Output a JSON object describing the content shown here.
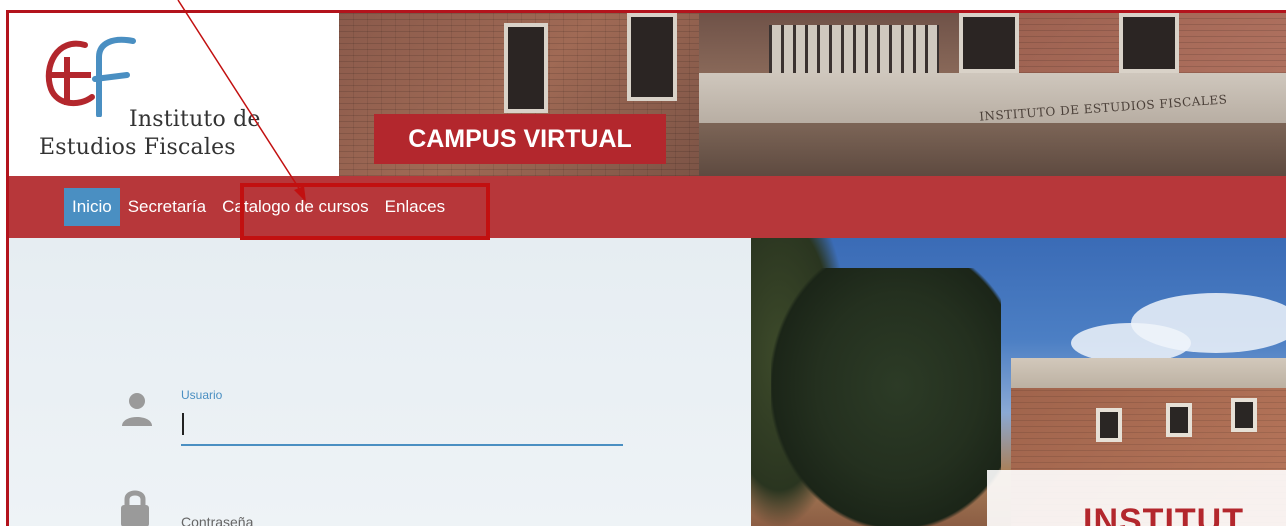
{
  "header": {
    "logo_line1": "Instituto de",
    "logo_line2": "Estudios Fiscales",
    "banner": "CAMPUS VIRTUAL",
    "inscription": "INSTITUTO DE ESTUDIOS FISCALES"
  },
  "nav": {
    "items": [
      {
        "label": "Inicio",
        "active": true
      },
      {
        "label": "Secretaría",
        "active": false
      },
      {
        "label": "Catalogo de cursos",
        "active": false
      },
      {
        "label": "Enlaces",
        "active": false
      }
    ]
  },
  "login": {
    "user_label": "Usuario",
    "password_placeholder": "Contraseña"
  },
  "photo": {
    "label": "INSTITUT"
  },
  "colors": {
    "brand_red": "#b3272d",
    "nav_red": "#b7373a",
    "active_blue": "#4a8fc2",
    "annotation_red": "#c21010"
  },
  "icons": {
    "user": "user-icon",
    "lock": "lock-icon",
    "logo": "ief-logo-icon"
  }
}
